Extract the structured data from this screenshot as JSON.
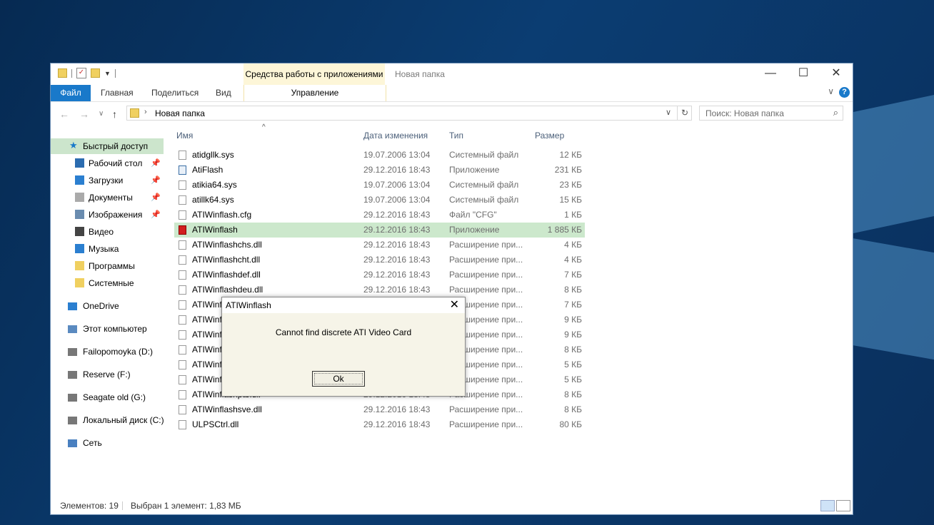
{
  "window": {
    "title": "Новая папка",
    "context_tools_header": "Средства работы с приложениями",
    "minimize": "—",
    "maximize": "☐",
    "close": "✕"
  },
  "ribbon": {
    "tabs": [
      "Файл",
      "Главная",
      "Поделиться",
      "Вид"
    ],
    "context_tab": "Управление",
    "accent": "#1979ca",
    "help": "?",
    "collapse": "∨"
  },
  "address": {
    "back": "←",
    "forward": "→",
    "history": "∨",
    "up": "↑",
    "chevron": "›",
    "path": "Новая папка",
    "dropdown": "∨",
    "refresh": "↻",
    "search_placeholder": "Поиск: Новая папка",
    "search_icon": "⌕"
  },
  "sidebar": {
    "quick_access": "Быстрый доступ",
    "pinned": [
      {
        "label": "Рабочий стол",
        "icon": "desktop-icon",
        "pin": "📌"
      },
      {
        "label": "Загрузки",
        "icon": "download-icon",
        "pin": "📌"
      },
      {
        "label": "Документы",
        "icon": "documents-icon",
        "pin": "📌"
      },
      {
        "label": "Изображения",
        "icon": "pictures-icon",
        "pin": "📌"
      },
      {
        "label": "Видео",
        "icon": "video-icon"
      },
      {
        "label": "Музыка",
        "icon": "music-icon"
      },
      {
        "label": "Программы",
        "icon": "folder-icon"
      },
      {
        "label": "Системные",
        "icon": "folder-icon"
      }
    ],
    "roots": [
      {
        "label": "OneDrive",
        "icon": "onedrive-icon"
      },
      {
        "label": "Этот компьютер",
        "icon": "computer-icon"
      },
      {
        "label": "Failopomoyka (D:)",
        "icon": "drive-icon"
      },
      {
        "label": "Reserve (F:)",
        "icon": "drive-icon"
      },
      {
        "label": "Seagate old (G:)",
        "icon": "drive-icon"
      },
      {
        "label": "Локальный диск (C:)",
        "icon": "drive-icon"
      },
      {
        "label": "Сеть",
        "icon": "network-icon"
      }
    ]
  },
  "columns": {
    "name": "Имя",
    "date": "Дата изменения",
    "type": "Тип",
    "size": "Размер",
    "sort_arrow": "^"
  },
  "files": [
    {
      "name": "atidgllk.sys",
      "date": "19.07.2006 13:04",
      "type": "Системный файл",
      "size": "12 КБ",
      "icon": "sys"
    },
    {
      "name": "AtiFlash",
      "date": "29.12.2016 18:43",
      "type": "Приложение",
      "size": "231 КБ",
      "icon": "app"
    },
    {
      "name": "atikia64.sys",
      "date": "19.07.2006 13:04",
      "type": "Системный файл",
      "size": "23 КБ",
      "icon": "sys"
    },
    {
      "name": "atillk64.sys",
      "date": "19.07.2006 13:04",
      "type": "Системный файл",
      "size": "15 КБ",
      "icon": "sys"
    },
    {
      "name": "ATIWinflash.cfg",
      "date": "29.12.2016 18:43",
      "type": "Файл \"CFG\"",
      "size": "1 КБ",
      "icon": "file"
    },
    {
      "name": "ATIWinflash",
      "date": "29.12.2016 18:43",
      "type": "Приложение",
      "size": "1 885 КБ",
      "icon": "ati",
      "selected": true
    },
    {
      "name": "ATIWinflashchs.dll",
      "date": "29.12.2016 18:43",
      "type": "Расширение при...",
      "size": "4 КБ",
      "icon": "dll"
    },
    {
      "name": "ATIWinflashcht.dll",
      "date": "29.12.2016 18:43",
      "type": "Расширение при...",
      "size": "4 КБ",
      "icon": "dll"
    },
    {
      "name": "ATIWinflashdef.dll",
      "date": "29.12.2016 18:43",
      "type": "Расширение при...",
      "size": "7 КБ",
      "icon": "dll"
    },
    {
      "name": "ATIWinflashdeu.dll",
      "date": "29.12.2016 18:43",
      "type": "Расширение при...",
      "size": "8 КБ",
      "icon": "dll"
    },
    {
      "name": "ATIWinf",
      "date": "",
      "type": "Расширение при...",
      "size": "7 КБ",
      "icon": "dll"
    },
    {
      "name": "ATIWinf",
      "date": "",
      "type": "Расширение при...",
      "size": "9 КБ",
      "icon": "dll"
    },
    {
      "name": "ATIWinf",
      "date": "",
      "type": "Расширение при...",
      "size": "9 КБ",
      "icon": "dll"
    },
    {
      "name": "ATIWinf",
      "date": "",
      "type": "Расширение при...",
      "size": "8 КБ",
      "icon": "dll"
    },
    {
      "name": "ATIWinf",
      "date": "",
      "type": "Расширение при...",
      "size": "5 КБ",
      "icon": "dll"
    },
    {
      "name": "ATIWinf",
      "date": "",
      "type": "Расширение при...",
      "size": "5 КБ",
      "icon": "dll"
    },
    {
      "name": "ATIWinflashptb.dll",
      "date": "29.12.2016 18:43",
      "type": "Расширение при...",
      "size": "8 КБ",
      "icon": "dll"
    },
    {
      "name": "ATIWinflashsve.dll",
      "date": "29.12.2016 18:43",
      "type": "Расширение при...",
      "size": "8 КБ",
      "icon": "dll"
    },
    {
      "name": "ULPSCtrl.dll",
      "date": "29.12.2016 18:43",
      "type": "Расширение при...",
      "size": "80 КБ",
      "icon": "dll"
    }
  ],
  "status": {
    "items": "Элементов: 19",
    "selection": "Выбран 1 элемент: 1,83 МБ"
  },
  "dialog": {
    "title": "ATIWinflash",
    "close": "✕",
    "message": "Cannot find discrete ATI Video Card",
    "ok": "Ok"
  }
}
